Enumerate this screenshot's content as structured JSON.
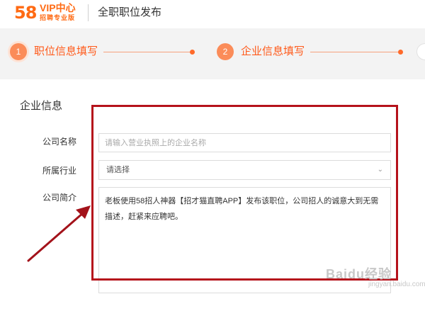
{
  "header": {
    "logo_text": "58",
    "brand_title": "VIP中心",
    "brand_subtitle": "招聘专业版",
    "page_title": "全职职位发布"
  },
  "steps": [
    {
      "number": "1",
      "label": "职位信息填写"
    },
    {
      "number": "2",
      "label": "企业信息填写"
    }
  ],
  "section": {
    "title": "企业信息"
  },
  "form": {
    "company_name": {
      "label": "公司名称",
      "placeholder": "请输入营业执照上的企业名称",
      "value": ""
    },
    "industry": {
      "label": "所属行业",
      "selected": "请选择"
    },
    "company_intro": {
      "label": "公司简介",
      "value": "老板使用58招人神器【招才猫直聘APP】发布该职位，公司招人的诚意大到无需描述，赶紧来应聘吧。"
    }
  },
  "annotation": {
    "highlight_color": "#b5121b",
    "arrow_color": "#a3121a"
  },
  "watermark": {
    "text": "Baidu经验",
    "sub": "jingyan.baidu.com"
  },
  "colors": {
    "brand_orange": "#ff6a13",
    "step_circle": "#fb8c59",
    "step_label": "#ff5a1a",
    "steps_background": "#f3f3f3"
  }
}
